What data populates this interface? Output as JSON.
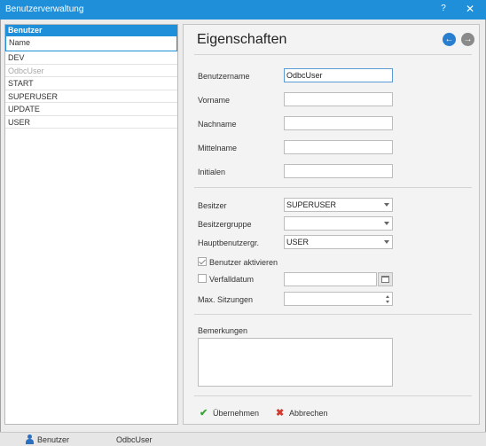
{
  "window": {
    "title": "Benutzerverwaltung",
    "help_label": "?",
    "close_label": "✕"
  },
  "user_list": {
    "header": "Benutzer",
    "column_header": "Name",
    "items": [
      {
        "name": "DEV",
        "muted": false
      },
      {
        "name": "OdbcUser",
        "muted": true
      },
      {
        "name": "START",
        "muted": false
      },
      {
        "name": "SUPERUSER",
        "muted": false
      },
      {
        "name": "UPDATE",
        "muted": false
      },
      {
        "name": "USER",
        "muted": false
      }
    ]
  },
  "properties": {
    "title": "Eigenschaften",
    "nav_back_glyph": "←",
    "nav_forward_glyph": "→",
    "fields": {
      "benutzername": {
        "label": "Benutzername",
        "value": "OdbcUser"
      },
      "vorname": {
        "label": "Vorname",
        "value": ""
      },
      "nachname": {
        "label": "Nachname",
        "value": ""
      },
      "mittelname": {
        "label": "Mittelname",
        "value": ""
      },
      "initialen": {
        "label": "Initialen",
        "value": ""
      }
    },
    "owner": {
      "besitzer": {
        "label": "Besitzer",
        "value": "SUPERUSER"
      },
      "besitzergruppe": {
        "label": "Besitzergruppe",
        "value": ""
      },
      "hauptbenutzergruppe": {
        "label": "Hauptbenutzergr.",
        "value": "USER"
      }
    },
    "benutzer_aktivieren": {
      "label": "Benutzer aktivieren",
      "checked": true
    },
    "verfalldatum": {
      "label": "Verfalldatum",
      "checked": false,
      "value": ""
    },
    "max_sitzungen": {
      "label": "Max. Sitzungen",
      "value": ""
    },
    "bemerkungen": {
      "label": "Bemerkungen",
      "value": ""
    },
    "actions": {
      "apply_label": "Übernehmen",
      "apply_icon": "✔",
      "cancel_label": "Abbrechen",
      "cancel_icon": "✖"
    }
  },
  "statusbar": {
    "section_label": "Benutzer",
    "current_user": "OdbcUser"
  },
  "colors": {
    "accent": "#1e8fd8",
    "apply_green": "#3aa43a",
    "cancel_red": "#d23a2f"
  }
}
